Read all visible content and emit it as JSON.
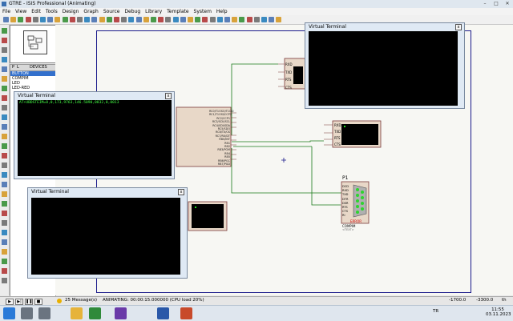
{
  "window": {
    "title": "GTRE - ISIS Professional (Animating)",
    "blurred_suffix": "",
    "min": "–",
    "max": "□",
    "close": "✕"
  },
  "menu": [
    "File",
    "View",
    "Edit",
    "Tools",
    "Design",
    "Graph",
    "Source",
    "Debug",
    "Library",
    "Template",
    "System",
    "Help"
  ],
  "toolbar": {
    "icons": [
      "new-icon",
      "open-icon",
      "save-icon",
      "import-icon",
      "export-icon",
      "print-icon",
      "area-icon",
      "refresh-icon",
      "grid-icon",
      "origin-icon",
      "pan-icon",
      "zoom-in-icon",
      "zoom-out-icon",
      "zoom-all-icon",
      "zoom-area-icon",
      "undo-icon",
      "redo-icon",
      "cut-icon",
      "copy-icon",
      "paste-icon",
      "block-copy-icon",
      "block-move-icon",
      "block-rotate-icon",
      "block-delete-icon",
      "pick-device-icon",
      "make-device-icon",
      "packaging-icon",
      "decompose-icon",
      "wire-autorouter-icon",
      "search-icon",
      "property-icon",
      "design-explorer-icon",
      "new-sheet-icon",
      "remove-sheet-icon",
      "exit-sheet-icon",
      "bom-icon",
      "erc-icon",
      "netlist-icon"
    ]
  },
  "devices_panel": {
    "tab_p": "P",
    "tab_l": "L",
    "title": "DEVICES",
    "items": [
      "BUTTON",
      "COMPIM",
      "LED",
      "LED-RED"
    ],
    "selected": 0
  },
  "terminals": [
    {
      "title": "Virtual Terminal",
      "close": "x",
      "text": "AT+UBDSTEIM=0,0,173,9763,146.5090,0832,0,0013"
    },
    {
      "title": "Virtual Terminal",
      "close": "x",
      "text": ""
    },
    {
      "title": "Virtual Terminal",
      "close": "x",
      "text": ""
    }
  ],
  "schematic": {
    "mcu_pins_left": [
      "RA0/AN0",
      "RA1/AN1",
      "RA2/AN2/VREF-",
      "RA3/AN3/VREF+",
      "RA4/T0CKI",
      "RA5/AN4/SS",
      "RE0/AN5/RD",
      "RE1/AN6/WR",
      "RE2/AN7/CS"
    ],
    "mcu_pins_right": [
      "RC0/T1OSO/T1CKI",
      "RC1/T1OSI/CCP2",
      "RC2/CCP1",
      "RC3/SCK/SCL",
      "RC4/SDI/SDA",
      "RC5/SDO",
      "RC6/TX/CK",
      "RC7/RX/DT",
      "RB0/INT",
      "RB1",
      "RB2",
      "RB3/PGM",
      "RB4",
      "RB5",
      "RB6/PGC",
      "RB7/PGD"
    ],
    "vt_pins": [
      "RXD",
      "TXD",
      "RTS",
      "CTS"
    ],
    "compim": {
      "ref": "P1",
      "name": "COMPIM",
      "sub": "<TEXT>",
      "pins": [
        "DCD",
        "RXD",
        "TXD",
        "DTR",
        "DSR",
        "RTS",
        "CTS",
        "RI"
      ],
      "label": "ERROR"
    }
  },
  "status": {
    "messages": "25 Message(s)",
    "animating": "ANIMATING: 00:00:15.000000 (CPU load 20%)",
    "x": "-1700.0",
    "y": "-3300.0",
    "unit": "th"
  },
  "playback": [
    "▶",
    "▶|",
    "❚❚",
    "■"
  ],
  "taskbar": {
    "apps": [
      "windows-start",
      "search",
      "file-explorer",
      "chrome",
      "visual-studio",
      "isis",
      "powerpoint"
    ],
    "lang": "TR",
    "time": "11:55",
    "date": "03.11.2023"
  }
}
